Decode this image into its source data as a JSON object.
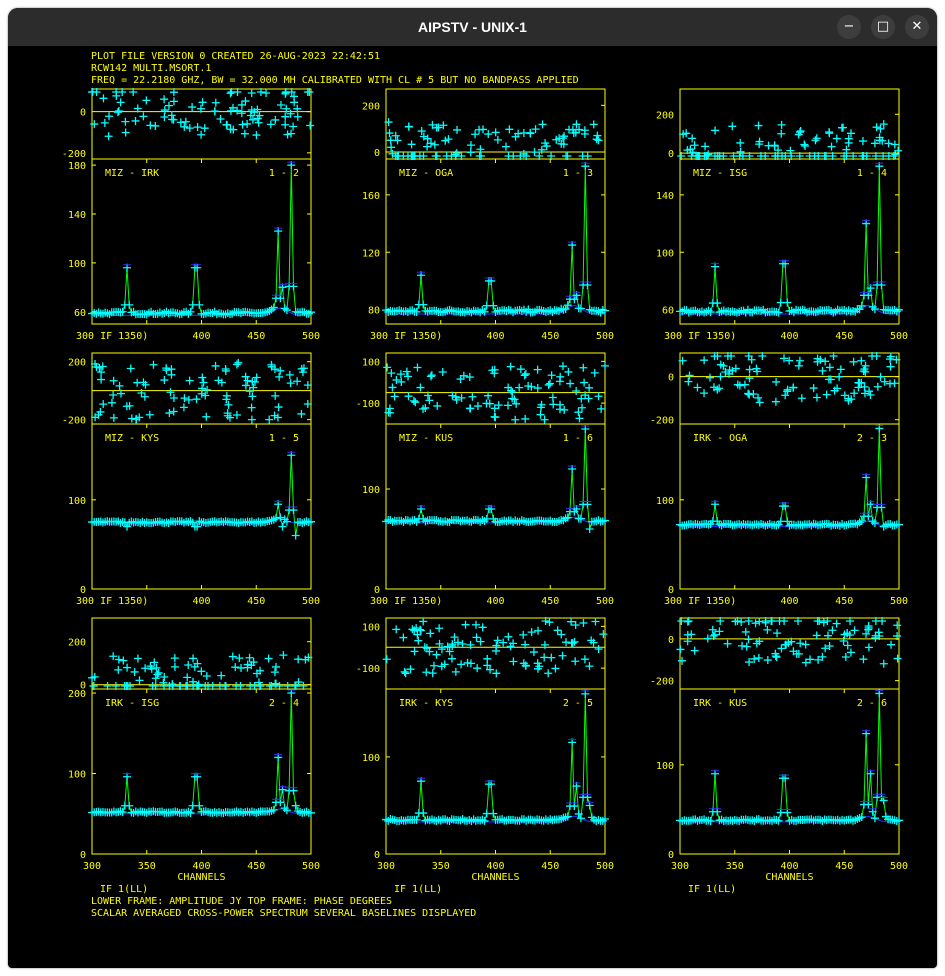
{
  "window": {
    "title": "AIPSTV - UNIX-1",
    "minimize_glyph": "−",
    "maximize_glyph": "□",
    "close_glyph": "✕"
  },
  "header": {
    "line1": "PLOT FILE VERSION 0  CREATED 26-AUG-2023 22:42:51",
    "line2": "RCW142   MULTI.MSORT.1",
    "line3": "FREQ = 22.2180 GHZ, BW = 32.000 MH   CALIBRATED WITH CL # 5 BUT NO BANDPASS APPLIED"
  },
  "footer": {
    "line1": "LOWER FRAME: AMPLITUDE JY   TOP FRAME: PHASE DEGREES",
    "line2": "SCALAR AVERAGED CROSS-POWER SPECTRUM    SEVERAL BASELINES DISPLAYED"
  },
  "colors": {
    "background": "#000000",
    "frame": "#ffff00",
    "text": "#ffff00",
    "points": "#00ffff",
    "amplitude_line": "#00ff00",
    "model_line": "#3030ff"
  },
  "chart_data": {
    "type": "scatter",
    "x_axis": {
      "label": "CHANNELS",
      "ticks": [
        "300",
        "350",
        "400",
        "450",
        "500"
      ],
      "range": [
        300,
        500
      ],
      "first_tick_row_1_2": "300 IF 1350)"
    },
    "panels": [
      {
        "name": "MIZ - IRK",
        "baseline": "1 - 2",
        "amp_ticks": [
          "60",
          "100",
          "140",
          "180"
        ],
        "amp_range": [
          50,
          185
        ],
        "amp_baseline": 59,
        "phase_ticks": [
          "0",
          "-200"
        ],
        "phase_range": [
          -230,
          110
        ],
        "phase_zero_line": 0,
        "phase_scatter": 120,
        "if_label": "",
        "peaks": [
          [
            332,
            96
          ],
          [
            395,
            96
          ],
          [
            470,
            126
          ],
          [
            474,
            80
          ],
          [
            482,
            180
          ],
          [
            486,
            60
          ]
        ]
      },
      {
        "name": "MIZ - OGA",
        "baseline": "1 - 3",
        "amp_ticks": [
          "80",
          "120",
          "160"
        ],
        "amp_range": [
          70,
          185
        ],
        "amp_baseline": 79,
        "phase_ticks": [
          "200",
          "0"
        ],
        "phase_range": [
          -30,
          270
        ],
        "phase_zero_line": 0,
        "phase_scatter": 130,
        "if_label": "",
        "peaks": [
          [
            332,
            104
          ],
          [
            395,
            100
          ],
          [
            470,
            125
          ],
          [
            474,
            90
          ],
          [
            482,
            180
          ],
          [
            486,
            80
          ]
        ]
      },
      {
        "name": "MIZ - ISG",
        "baseline": "1 - 4",
        "amp_ticks": [
          "60",
          "100",
          "140"
        ],
        "amp_range": [
          50,
          165
        ],
        "amp_baseline": 59,
        "phase_ticks": [
          "200",
          "0"
        ],
        "phase_range": [
          -30,
          330
        ],
        "phase_zero_line": 0,
        "phase_scatter": 150,
        "if_label": "",
        "peaks": [
          [
            332,
            90
          ],
          [
            395,
            92
          ],
          [
            470,
            120
          ],
          [
            474,
            75
          ],
          [
            482,
            160
          ],
          [
            486,
            60
          ]
        ]
      },
      {
        "name": "MIZ - KYS",
        "baseline": "1 - 5",
        "amp_ticks": [
          "100",
          "0"
        ],
        "amp_range": [
          0,
          185
        ],
        "amp_baseline": 75,
        "phase_ticks": [
          "200",
          "-200"
        ],
        "phase_range": [
          -230,
          260
        ],
        "phase_zero_line": 0,
        "phase_scatter": 200,
        "if_label": "",
        "peaks": [
          [
            332,
            70
          ],
          [
            395,
            70
          ],
          [
            470,
            95
          ],
          [
            474,
            70
          ],
          [
            482,
            150
          ],
          [
            486,
            60
          ]
        ]
      },
      {
        "name": "MIZ - KUS",
        "baseline": "1 - 6",
        "amp_ticks": [
          "100",
          "0"
        ],
        "amp_range": [
          0,
          165
        ],
        "amp_baseline": 68,
        "phase_ticks": [
          "100",
          "-100"
        ],
        "phase_range": [
          -200,
          140
        ],
        "phase_zero_line": -50,
        "phase_scatter": 130,
        "if_label": "",
        "peaks": [
          [
            332,
            80
          ],
          [
            395,
            80
          ],
          [
            470,
            120
          ],
          [
            474,
            80
          ],
          [
            482,
            160
          ],
          [
            486,
            60
          ]
        ]
      },
      {
        "name": "IRK - OGA",
        "baseline": "2 - 3",
        "amp_ticks": [
          "100",
          "0"
        ],
        "amp_range": [
          0,
          185
        ],
        "amp_baseline": 72,
        "phase_ticks": [
          "0",
          "-200"
        ],
        "phase_range": [
          -220,
          110
        ],
        "phase_zero_line": 0,
        "phase_scatter": 120,
        "if_label": "",
        "peaks": [
          [
            332,
            95
          ],
          [
            395,
            93
          ],
          [
            470,
            125
          ],
          [
            474,
            95
          ],
          [
            482,
            180
          ],
          [
            486,
            70
          ]
        ]
      },
      {
        "name": "IRK - ISG",
        "baseline": "2 - 4",
        "amp_ticks": [
          "200",
          "100",
          "0"
        ],
        "amp_range": [
          0,
          205
        ],
        "amp_baseline": 52,
        "phase_ticks": [
          "200",
          "0"
        ],
        "phase_range": [
          -20,
          310
        ],
        "phase_zero_line": 0,
        "phase_scatter": 150,
        "if_label": "IF 1(LL)",
        "peaks": [
          [
            332,
            96
          ],
          [
            395,
            96
          ],
          [
            470,
            120
          ],
          [
            474,
            80
          ],
          [
            482,
            200
          ],
          [
            486,
            60
          ]
        ]
      },
      {
        "name": "IRK - KYS",
        "baseline": "2 - 5",
        "amp_ticks": [
          "100",
          "0"
        ],
        "amp_range": [
          0,
          170
        ],
        "amp_baseline": 35,
        "phase_ticks": [
          "100",
          "-100"
        ],
        "phase_range": [
          -200,
          140
        ],
        "phase_zero_line": 0,
        "phase_scatter": 130,
        "if_label": "IF 1(LL)",
        "peaks": [
          [
            332,
            75
          ],
          [
            395,
            72
          ],
          [
            470,
            115
          ],
          [
            474,
            70
          ],
          [
            482,
            165
          ],
          [
            486,
            50
          ]
        ]
      },
      {
        "name": "IRK - KUS",
        "baseline": "2 - 6",
        "amp_ticks": [
          "100",
          "0"
        ],
        "amp_range": [
          0,
          185
        ],
        "amp_baseline": 38,
        "phase_ticks": [
          "0",
          "-200"
        ],
        "phase_range": [
          -240,
          100
        ],
        "phase_zero_line": 0,
        "phase_scatter": 120,
        "if_label": "IF 1(LL)",
        "peaks": [
          [
            332,
            90
          ],
          [
            395,
            85
          ],
          [
            470,
            135
          ],
          [
            474,
            90
          ],
          [
            482,
            180
          ],
          [
            486,
            60
          ]
        ]
      }
    ]
  }
}
